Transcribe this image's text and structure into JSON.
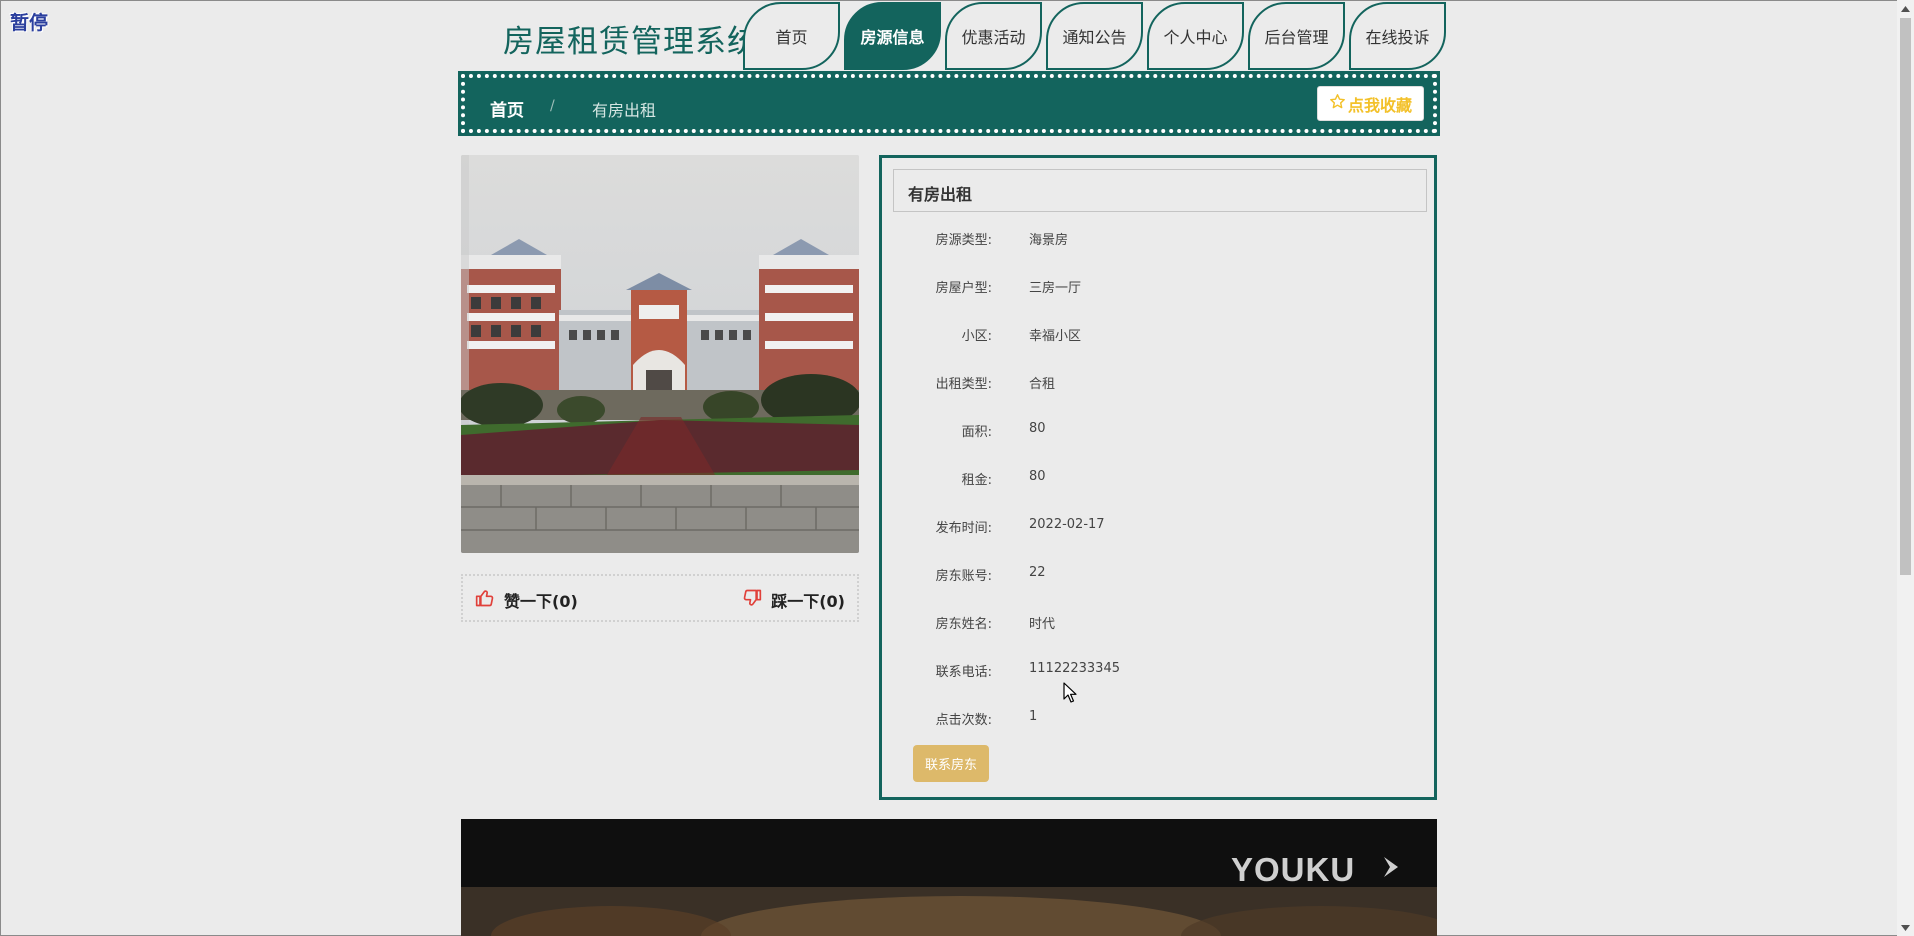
{
  "overlay": {
    "pause_label": "暂停"
  },
  "header": {
    "site_title": "房屋租赁管理系统",
    "nav": [
      {
        "label": "首页",
        "active": false
      },
      {
        "label": "房源信息",
        "active": true
      },
      {
        "label": "优惠活动",
        "active": false
      },
      {
        "label": "通知公告",
        "active": false
      },
      {
        "label": "个人中心",
        "active": false
      },
      {
        "label": "后台管理",
        "active": false
      },
      {
        "label": "在线投诉",
        "active": false
      }
    ]
  },
  "breadcrumb": {
    "home": "首页",
    "separator": "/",
    "current": "有房出租",
    "favorite_label": "点我收藏"
  },
  "feedback": {
    "like_label": "赞一下(0)",
    "dislike_label": "踩一下(0)"
  },
  "detail": {
    "title": "有房出租",
    "fields": [
      {
        "label": "房源类型:",
        "value": "海景房"
      },
      {
        "label": "房屋户型:",
        "value": "三房一厅"
      },
      {
        "label": "小区:",
        "value": "幸福小区"
      },
      {
        "label": "出租类型:",
        "value": "合租"
      },
      {
        "label": "面积:",
        "value": "80"
      },
      {
        "label": "租金:",
        "value": "80"
      },
      {
        "label": "发布时间:",
        "value": "2022-02-17"
      },
      {
        "label": "房东账号:",
        "value": "22"
      },
      {
        "label": "房东姓名:",
        "value": "时代"
      },
      {
        "label": "联系电话:",
        "value": "11122233345"
      },
      {
        "label": "点击次数:",
        "value": "1"
      }
    ],
    "contact_label": "联系房东"
  },
  "video": {
    "watermark": "YOUKU"
  },
  "colors": {
    "brand": "#13645d",
    "page_bg": "#ebebeb",
    "favorite": "#f3c12a",
    "contact_button": "#ddb96a",
    "thumb_icon": "#e0403a"
  }
}
